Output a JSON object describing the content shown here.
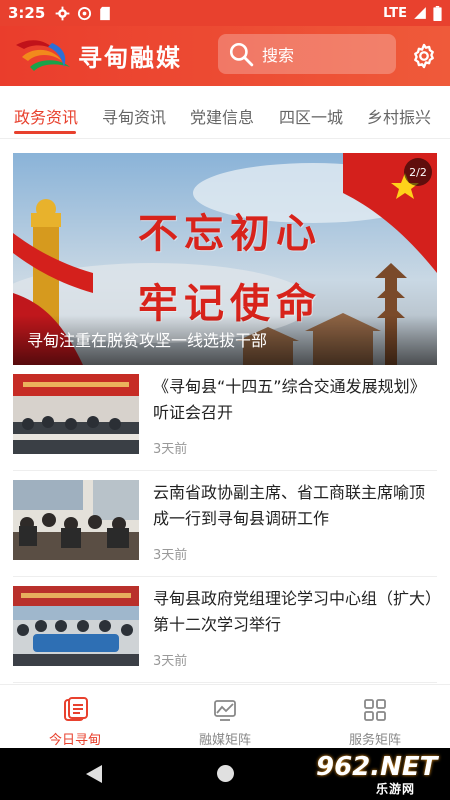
{
  "statusbar": {
    "time": "3:25",
    "network": "LTE"
  },
  "header": {
    "brand": "寻甸融媒",
    "search_placeholder": "搜索"
  },
  "tabs": [
    "政务资讯",
    "寻甸资讯",
    "党建信息",
    "四区一城",
    "乡村振兴"
  ],
  "active_tab": 0,
  "banner": {
    "slogan_line1": "不忘初心",
    "slogan_line2": "牢记使命",
    "caption": "寻甸注重在脱贫攻坚一线选拔干部",
    "counter": "2/2"
  },
  "news": [
    {
      "title": "《寻甸县“十四五”综合交通发展规划》听证会召开",
      "time": "3天前"
    },
    {
      "title": "云南省政协副主席、省工商联主席喻顶成一行到寻甸县调研工作",
      "time": "3天前"
    },
    {
      "title": "寻甸县政府党组理论学习中心组（扩大）第十二次学习举行",
      "time": "3天前"
    }
  ],
  "bottom_nav": [
    {
      "label": "今日寻甸",
      "icon": "news-document-icon"
    },
    {
      "label": "融媒矩阵",
      "icon": "media-matrix-icon"
    },
    {
      "label": "服务矩阵",
      "icon": "service-grid-icon"
    }
  ],
  "watermark": {
    "big": "962.NET",
    "small": "乐游网"
  },
  "colors": {
    "accent": "#e8412e",
    "inactive": "#888888"
  }
}
